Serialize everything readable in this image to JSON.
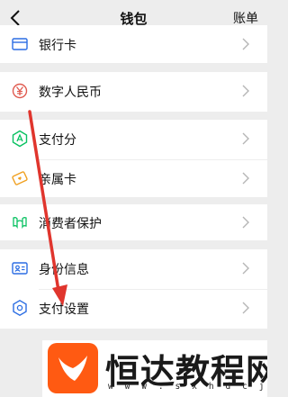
{
  "header": {
    "title": "钱包",
    "right_label": "账单"
  },
  "groups": [
    {
      "items": [
        {
          "label": "银行卡",
          "icon": "bank-card-icon"
        }
      ]
    },
    {
      "items": [
        {
          "label": "数字人民币",
          "icon": "digital-rmb-icon"
        }
      ]
    },
    {
      "items": [
        {
          "label": "支付分",
          "icon": "pay-score-icon"
        },
        {
          "label": "亲属卡",
          "icon": "family-card-icon"
        }
      ]
    },
    {
      "items": [
        {
          "label": "消费者保护",
          "icon": "consumer-protection-icon"
        }
      ]
    },
    {
      "items": [
        {
          "label": "身份信息",
          "icon": "identity-info-icon"
        },
        {
          "label": "支付设置",
          "icon": "payment-settings-icon"
        }
      ]
    }
  ],
  "colors": {
    "accent_green": "#07c160",
    "rmb_red": "#e05a4f",
    "arrow_red": "#e0352d",
    "id_blue": "#2b6de3",
    "watermark_orange": "#ff5a12"
  },
  "watermark": {
    "text": "恒达教程网",
    "url": "w w w . s x h d c j . c o m"
  }
}
